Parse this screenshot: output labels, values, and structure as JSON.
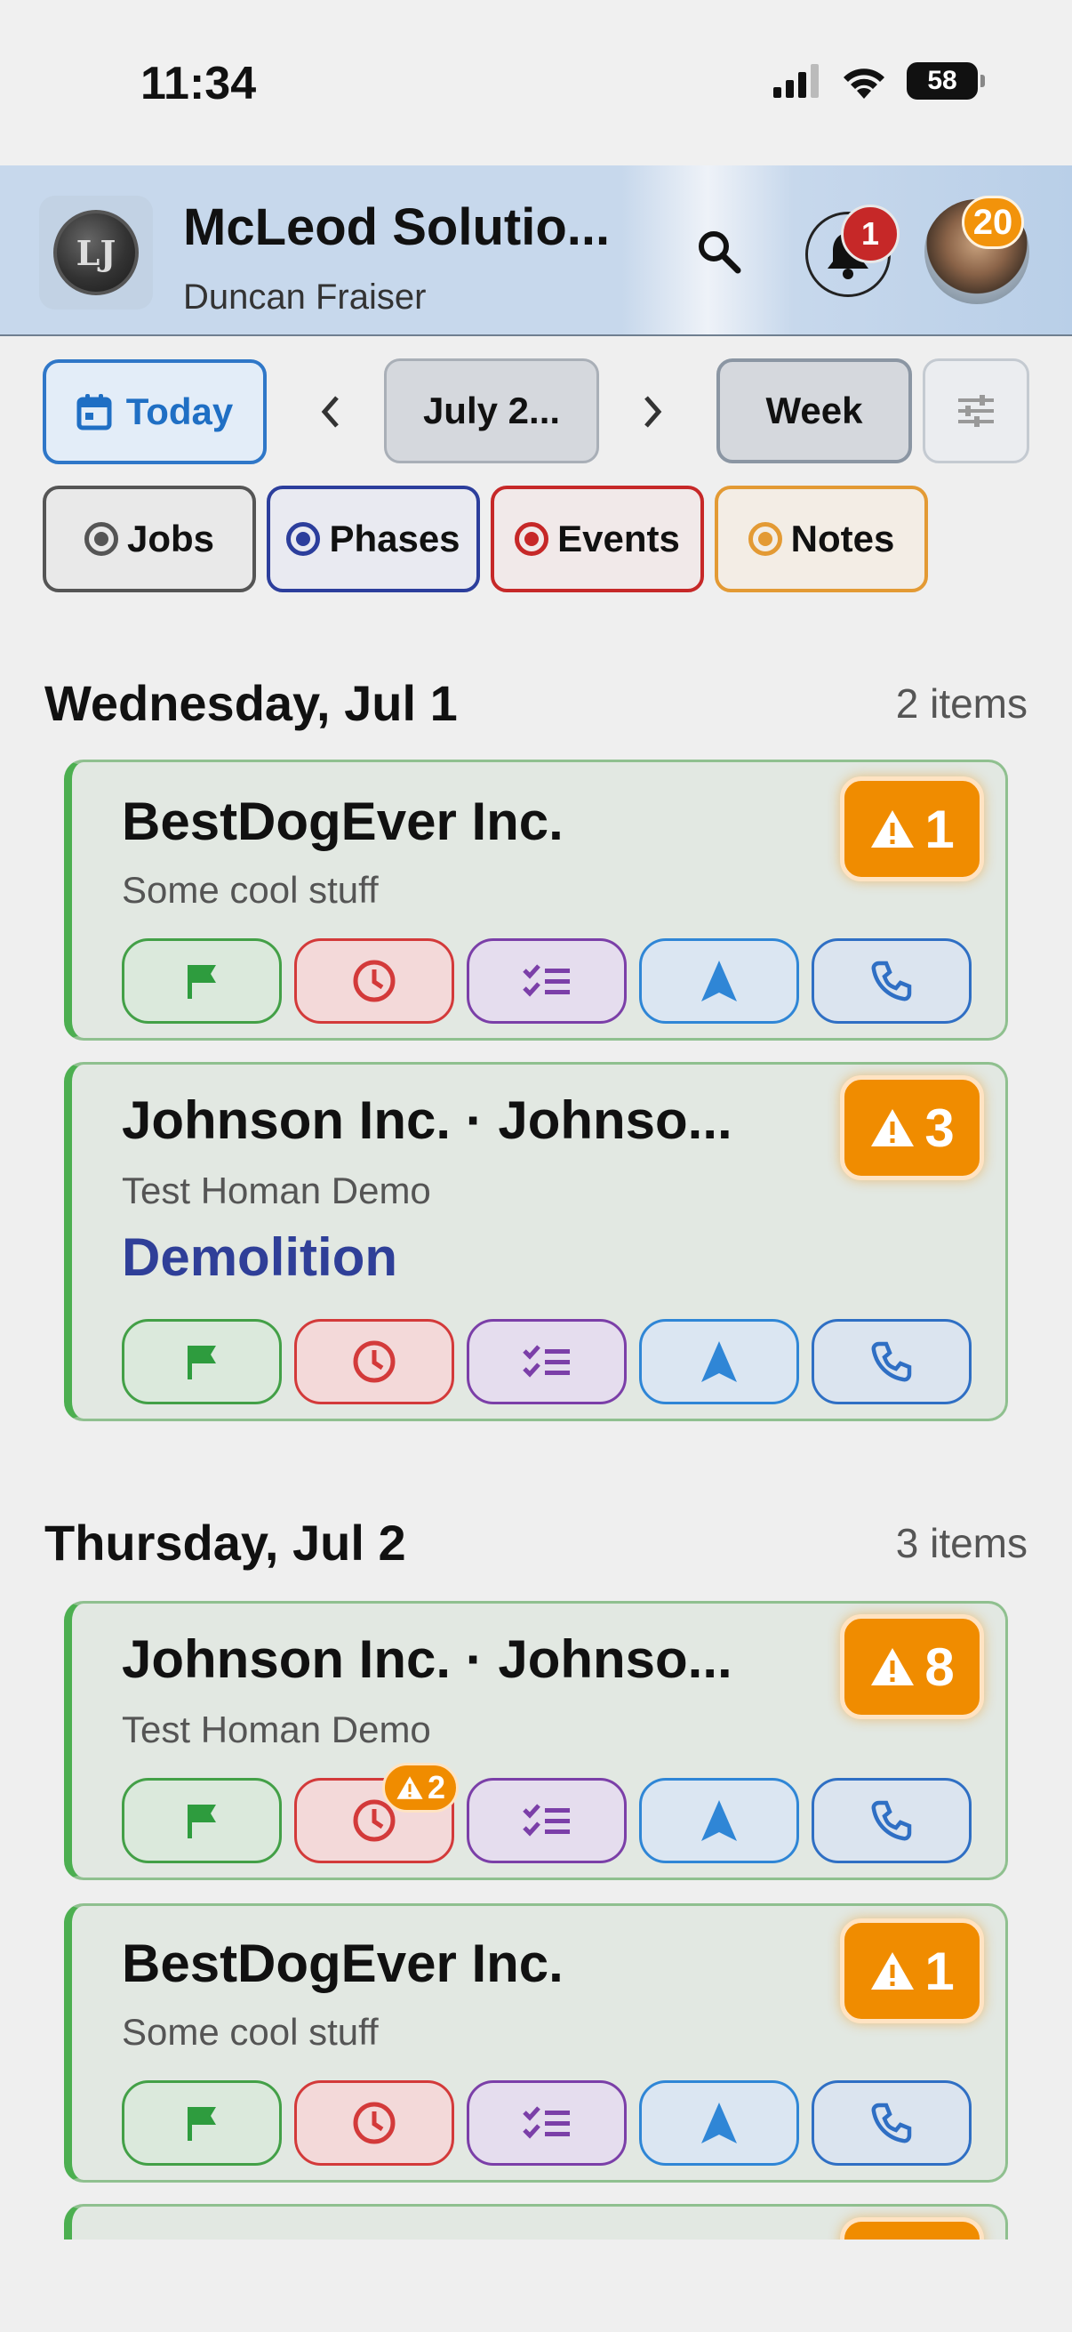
{
  "status_bar": {
    "time": "11:34",
    "battery": "58"
  },
  "header": {
    "company": "McLeod Solutio...",
    "user": "Duncan Fraiser",
    "logo_text": "LJ",
    "notification_count": "1",
    "profile_badge": "20"
  },
  "toolbar": {
    "today_label": "Today",
    "month_label": "July 2...",
    "week_label": "Week"
  },
  "filters": [
    {
      "label": "Jobs",
      "color": "#555555"
    },
    {
      "label": "Phases",
      "color": "#2c3e9c"
    },
    {
      "label": "Events",
      "color": "#c62828"
    },
    {
      "label": "Notes",
      "color": "#e39a34"
    }
  ],
  "days": [
    {
      "title": "Wednesday, Jul 1",
      "count": "2 items",
      "cards": [
        {
          "title": "BestDogEver Inc.",
          "subtitle": "Some cool stuff",
          "warning_count": "1"
        },
        {
          "title": "Johnson Inc. · Johnso...",
          "subtitle": "Test Homan Demo",
          "phase": "Demolition",
          "warning_count": "3"
        }
      ]
    },
    {
      "title": "Thursday, Jul 2",
      "count": "3 items",
      "cards": [
        {
          "title": "Johnson Inc. · Johnso...",
          "subtitle": "Test Homan Demo",
          "warning_count": "8",
          "time_badge": "2"
        },
        {
          "title": "BestDogEver Inc.",
          "subtitle": "Some cool stuff",
          "warning_count": "1"
        }
      ]
    }
  ],
  "icons": [
    "signal-icon",
    "wifi-icon",
    "battery-icon",
    "search-icon",
    "bell-icon",
    "calendar-icon",
    "chevron-left-icon",
    "chevron-right-icon",
    "filter-sliders-icon",
    "warning-icon",
    "flag-icon",
    "clock-icon",
    "checklist-icon",
    "navigation-icon",
    "phone-icon"
  ]
}
